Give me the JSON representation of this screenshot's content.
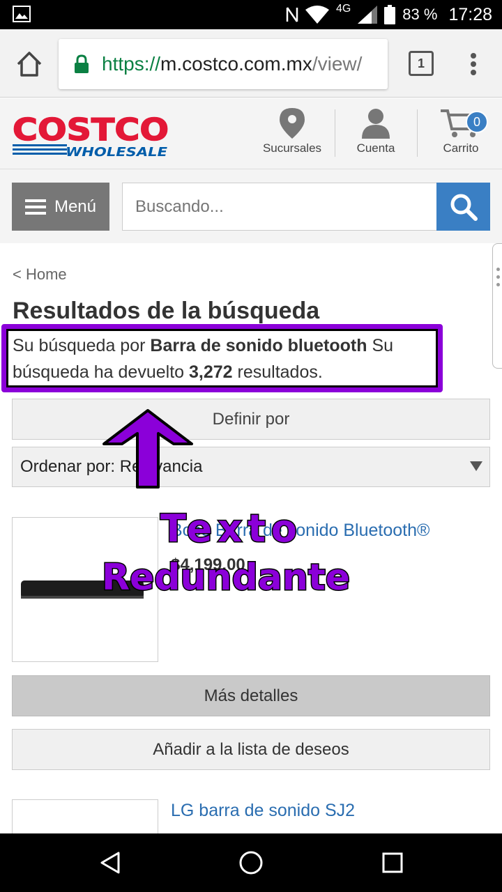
{
  "status_bar": {
    "battery_percent": "83 %",
    "time": "17:28",
    "network": "4G",
    "icons": [
      "image-icon",
      "nfc-icon",
      "wifi-icon",
      "signal-icon",
      "battery-icon"
    ]
  },
  "browser": {
    "url_scheme": "https://",
    "url_host": "m.costco.com.mx",
    "url_path": "/view/",
    "tab_count": "1"
  },
  "header": {
    "logo_top": "COSTCO",
    "logo_bottom": "WHOLESALE",
    "stores_label": "Sucursales",
    "account_label": "Cuenta",
    "cart_label": "Carrito",
    "cart_count": "0"
  },
  "search": {
    "menu_label": "Menú",
    "placeholder": "Buscando..."
  },
  "results": {
    "breadcrumb": "< Home",
    "title": "Resultados de la búsqueda",
    "desc_prefix": "Su búsqueda por ",
    "query": "Barra de sonido bluetooth",
    "desc_middle": " Su búsqueda ha devuelto ",
    "count": "3,272",
    "desc_suffix": " resultados.",
    "refine_label": "Definir por",
    "sort_label": "Ordenar por: Relevancia"
  },
  "products": [
    {
      "title": "Bose Barra de sonido Bluetooth®",
      "price": "$4,199.00",
      "details_label": "Más detalles",
      "wishlist_label": "Añadir a la lista de deseos"
    },
    {
      "title": "LG barra de sonido SJ2"
    }
  ],
  "annotation": {
    "line1": "Texto",
    "line2": "Redundante",
    "color": "#8b00d9"
  },
  "colors": {
    "costco_red": "#e31837",
    "costco_blue": "#005daa",
    "link_blue": "#2a6db0",
    "search_blue": "#3a7fc4"
  }
}
